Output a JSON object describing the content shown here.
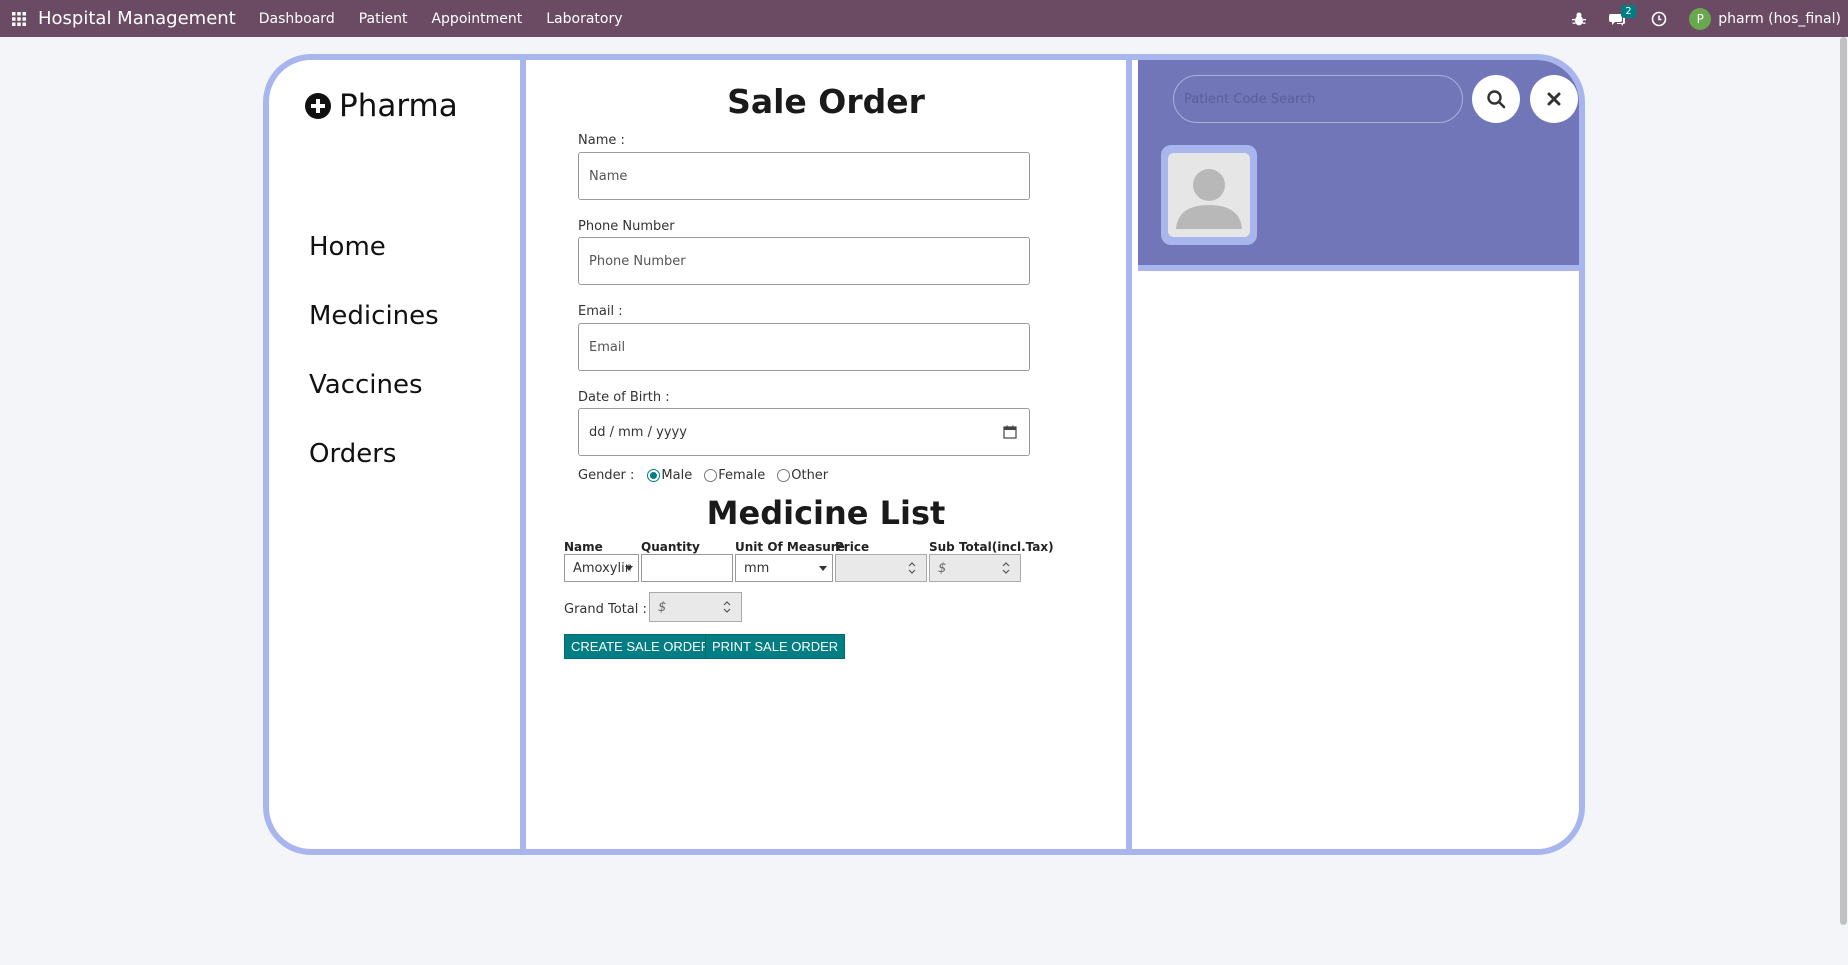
{
  "navbar": {
    "brand": "Hospital Management",
    "menu": [
      "Dashboard",
      "Patient",
      "Appointment",
      "Laboratory"
    ],
    "chat_badge": "2",
    "avatar_letter": "P",
    "user": "pharm (hos_final)"
  },
  "sidebar": {
    "logo_text": "Pharma",
    "links": [
      "Home",
      "Medicines",
      "Vaccines",
      "Orders"
    ]
  },
  "form": {
    "title": "Sale Order",
    "name_label": "Name :",
    "name_placeholder": "Name",
    "phone_label": "Phone Number",
    "phone_placeholder": "Phone Number",
    "email_label": "Email :",
    "email_placeholder": "Email",
    "dob_label": "Date of Birth :",
    "dob_placeholder": "dd / mm / yyyy",
    "gender_label": "Gender :",
    "gender_options": [
      "Male",
      "Female",
      "Other"
    ],
    "gender_selected": "Male"
  },
  "medicine_list": {
    "title": "Medicine List",
    "columns": [
      "Name",
      "Quantity",
      "Unit Of Measure",
      "Price",
      "Sub Total(incl.Tax)"
    ],
    "row": {
      "name": "Amoxylin",
      "quantity": "",
      "uom": "mm",
      "price": "",
      "subtotal_placeholder": "$"
    },
    "grand_total_label": "Grand Total :",
    "grand_total_placeholder": "$",
    "create_button": "CREATE SALE ORDER",
    "print_button": "PRINT SALE ORDER"
  },
  "patient_panel": {
    "search_placeholder": "Patient Code Search"
  },
  "colors": {
    "navbar": "#6b4a63",
    "frame_border": "#a9b6ee",
    "panel": "#7076b8",
    "primary_button": "#017e84"
  }
}
